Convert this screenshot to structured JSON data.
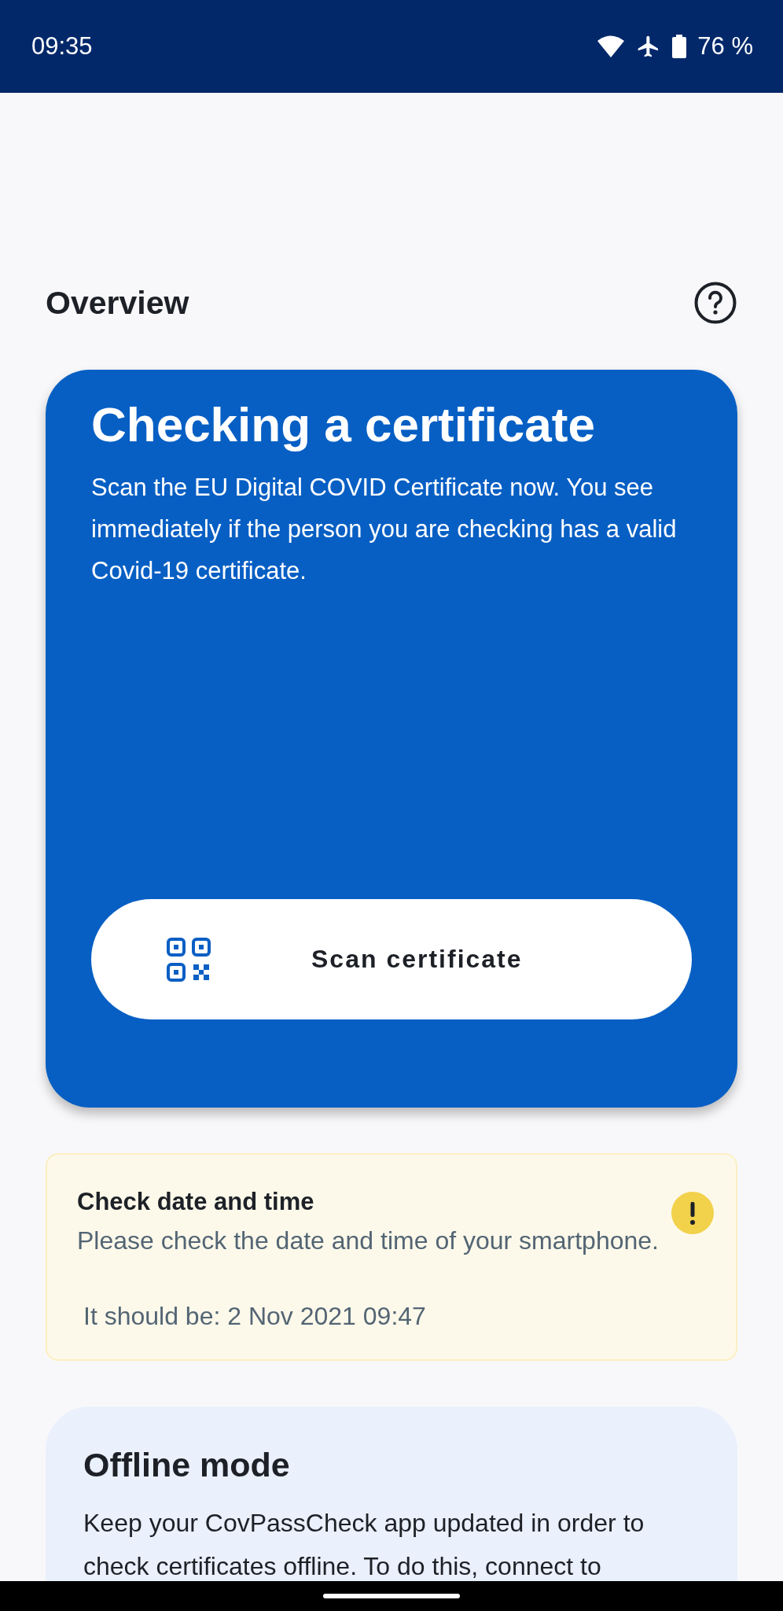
{
  "status_bar": {
    "time": "09:35",
    "battery": "76 %"
  },
  "header": {
    "title": "Overview"
  },
  "check_card": {
    "title": "Checking a certificate",
    "text": "Scan the EU Digital COVID Certificate now. You see immediately if the person you are checking has a valid Covid-19 certificate.",
    "button": "Scan certificate"
  },
  "notice": {
    "title": "Check date and time",
    "text": "Please check the date and time of your smartphone.",
    "detail": "It should be: 2 Nov 2021 09:47"
  },
  "offline_card": {
    "title": "Offline mode",
    "text": "Keep your CovPassCheck app updated in order to check certificates offline. To do this, connect to"
  }
}
